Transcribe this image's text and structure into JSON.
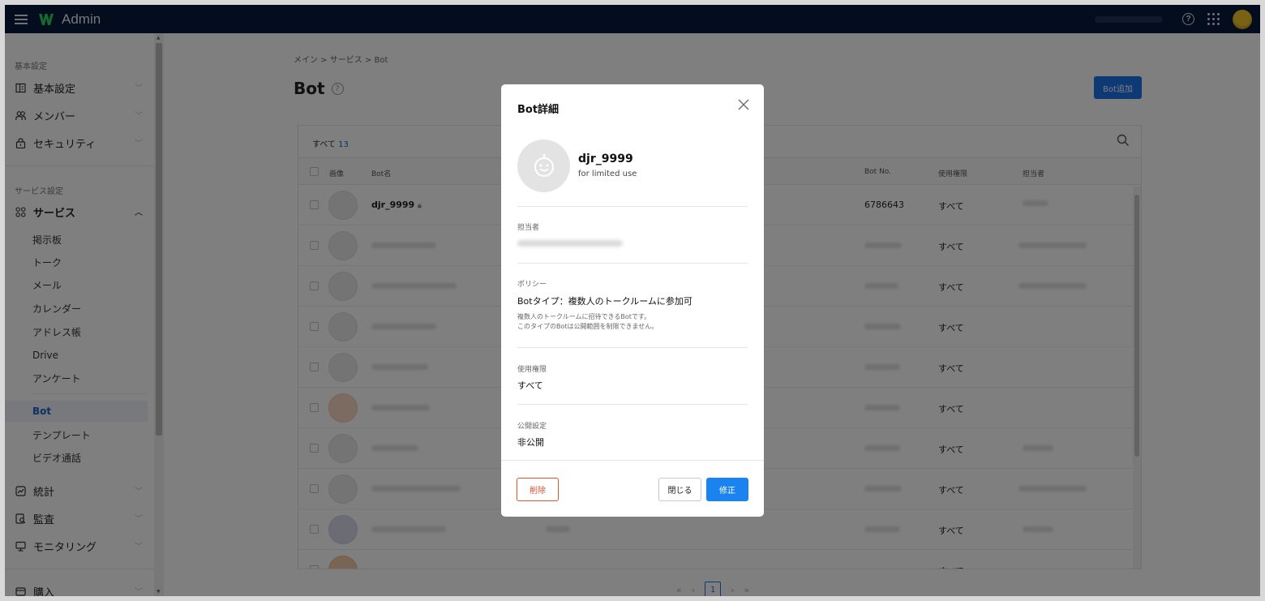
{
  "app": {
    "title": "Admin",
    "accent": "#1a73e8",
    "topbar_color": "#081a3a"
  },
  "sidebar": {
    "section_basic": "基本設定",
    "basic_items": [
      {
        "label": "基本設定",
        "icon": "building-icon"
      },
      {
        "label": "メンバー",
        "icon": "members-icon"
      },
      {
        "label": "セキュリティ",
        "icon": "lock-icon"
      }
    ],
    "section_service": "サービス設定",
    "service_label": "サービス",
    "service_subitems": [
      "掲示板",
      "トーク",
      "メール",
      "カレンダー",
      "アドレス帳",
      "Drive",
      "アンケート",
      "Bot",
      "テンプレート",
      "ビデオ通話"
    ],
    "active_subitem": "Bot",
    "lower_items": [
      {
        "label": "統計",
        "icon": "stats-icon"
      },
      {
        "label": "監査",
        "icon": "audit-icon"
      },
      {
        "label": "モニタリング",
        "icon": "monitor-icon"
      },
      {
        "label": "購入",
        "icon": "purchase-icon"
      }
    ]
  },
  "main": {
    "breadcrumb": "メイン > サービス > Bot",
    "title": "Bot",
    "add_button": "Bot追加",
    "filter_label": "すべて",
    "count": "13",
    "columns": {
      "image": "画像",
      "name": "Bot名",
      "bot_no": "Bot No.",
      "permission": "使用権限",
      "owner": "担当者"
    },
    "first_row": {
      "name": "djr_9999",
      "bot_no": "6786643",
      "permission": "すべて"
    },
    "row_permission": "すべて",
    "pagination": {
      "current": "1"
    }
  },
  "modal": {
    "title": "Bot詳細",
    "bot_name": "djr_9999",
    "bot_description": "for limited use",
    "owner_label": "担当者",
    "policy_label": "ポリシー",
    "policy_value": "Botタイプ：複数人のトークルームに参加可",
    "policy_note_1": "複数人のトークルームに招待できるBotです。",
    "policy_note_2": "このタイプのBotは公開範囲を制限できません。",
    "permission_label": "使用権限",
    "permission_value": "すべて",
    "visibility_label": "公開設定",
    "visibility_value": "非公開",
    "delete_button": "削除",
    "close_button": "閉じる",
    "edit_button": "修正"
  }
}
